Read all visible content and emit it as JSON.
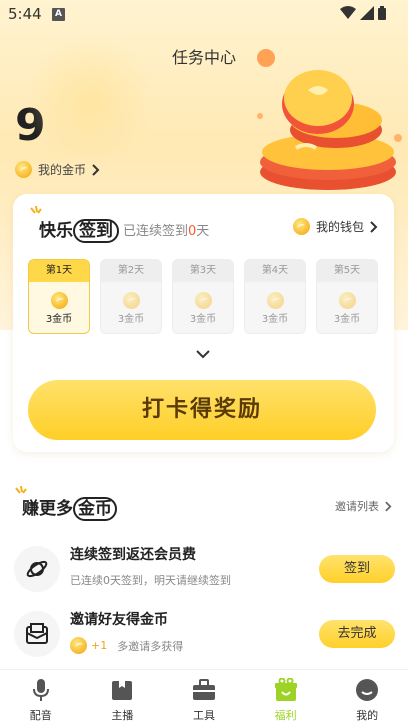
{
  "status": {
    "time": "5:44",
    "notice": "A"
  },
  "header": {
    "title": "任务中心"
  },
  "coins": {
    "count": "9",
    "label": "我的金币"
  },
  "signin": {
    "title_prefix": "快乐",
    "title_word": "签到",
    "streak_prefix": "已连续签到",
    "streak_days": "0",
    "streak_suffix": "天",
    "wallet_label": "我的钱包",
    "days": [
      {
        "label": "第1天",
        "reward": "3金币",
        "active": true
      },
      {
        "label": "第2天",
        "reward": "3金币",
        "active": false
      },
      {
        "label": "第3天",
        "reward": "3金币",
        "active": false
      },
      {
        "label": "第4天",
        "reward": "3金币",
        "active": false
      },
      {
        "label": "第5天",
        "reward": "3金币",
        "active": false
      }
    ],
    "button_label": "打卡得奖励"
  },
  "earn": {
    "title_prefix": "赚更多",
    "title_word": "金币",
    "invite_list_label": "邀请列表",
    "tasks": [
      {
        "title": "连续签到返还会员费",
        "subtitle": "已连续0天签到，明天请继续签到",
        "button": "签到",
        "icon": "planet-icon"
      },
      {
        "title": "邀请好友得金币",
        "reward": "+1",
        "subtitle": "多邀请多获得",
        "button": "去完成",
        "icon": "envelope-icon"
      }
    ]
  },
  "tabs": [
    {
      "label": "配音",
      "icon": "microphone-icon",
      "active": false
    },
    {
      "label": "主播",
      "icon": "anchor-icon",
      "active": false
    },
    {
      "label": "工具",
      "icon": "toolbox-icon",
      "active": false
    },
    {
      "label": "福利",
      "icon": "gift-icon",
      "active": true
    },
    {
      "label": "我的",
      "icon": "profile-icon",
      "active": false
    }
  ],
  "colors": {
    "accent": "#FFD02A",
    "active_tab": "#9DD226",
    "streak_number": "#FF5A2A"
  }
}
